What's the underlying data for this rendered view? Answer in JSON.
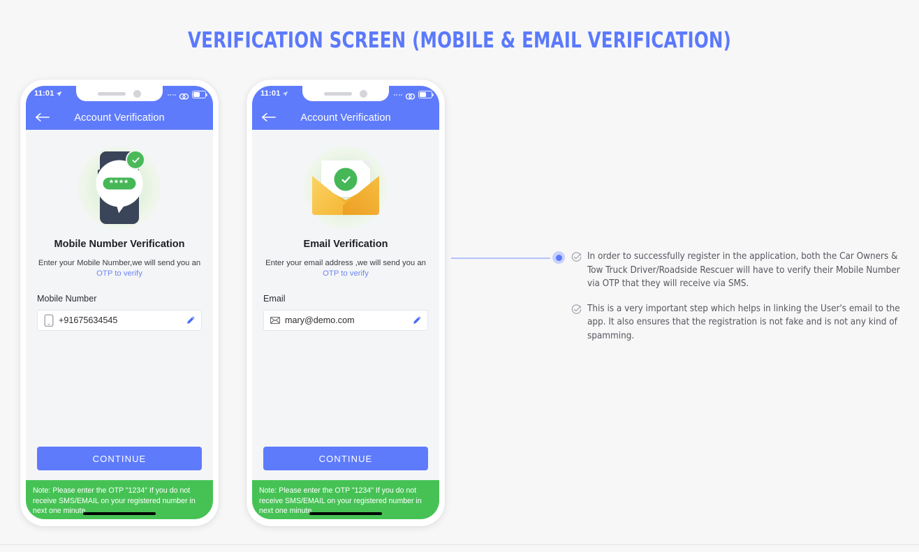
{
  "title": "VERIFICATION SCREEN (MOBILE & EMAIL VERIFICATION)",
  "colors": {
    "accent_blue": "#5e7bfc",
    "title_blue": "#5b79fb",
    "note_green": "#46c255",
    "check_green": "#46b757",
    "envelope_orange": "#f0a62a",
    "page_bg": "#f7f7f8",
    "screen_bg": "#f4f5f7"
  },
  "phones": [
    {
      "id": "mobile-verification",
      "status_bar": {
        "time": "11:01",
        "location_icon": "location-arrow-icon",
        "signal_icon": "signal-dots-icon",
        "connection_icon": "chain-link-icon",
        "battery_icon": "battery-icon"
      },
      "appbar": {
        "back_icon": "back-arrow-icon",
        "title": "Account Verification"
      },
      "illustration": {
        "name": "mobile-otp-illustration",
        "otp_mask": "****",
        "badge_icon": "green-check-badge-icon"
      },
      "section_title": "Mobile Number  Verification",
      "section_subtitle": "Enter your Mobile Number,we will send you an",
      "section_link": "OTP to verify",
      "field": {
        "label": "Mobile Number",
        "icon": "phone-icon",
        "value": "+91675634545",
        "placeholder": "+91675634545",
        "edit_icon": "pencil-icon"
      },
      "cta_label": "CONTINUE",
      "note": "Note: Please enter the OTP \"1234\" If you do not receive SMS/EMAIL on your registered number in next one minute."
    },
    {
      "id": "email-verification",
      "status_bar": {
        "time": "11:01",
        "location_icon": "location-arrow-icon",
        "signal_icon": "signal-dots-icon",
        "connection_icon": "chain-link-icon",
        "battery_icon": "battery-icon"
      },
      "appbar": {
        "back_icon": "back-arrow-icon",
        "title": "Account Verification"
      },
      "illustration": {
        "name": "email-envelope-illustration",
        "badge_icon": "green-check-badge-icon"
      },
      "section_title": "Email Verification",
      "section_subtitle": "Enter your email address ,we will send you an",
      "section_link": "OTP to verify",
      "field": {
        "label": "Email",
        "icon": "envelope-icon",
        "value": "mary@demo.com",
        "placeholder": "mary@demo.com",
        "edit_icon": "pencil-icon"
      },
      "cta_label": "CONTINUE",
      "note": "Note: Please enter the OTP \"1234\" If you do not receive SMS/EMAIL on your registered number in next one minute."
    }
  ],
  "annotations": {
    "connector": {
      "dot_icon": "connector-dot-icon"
    },
    "items": [
      {
        "icon": "circle-check-icon",
        "text": "In order to successfully register in the application, both the Car Owners & Tow Truck Driver/Roadside Rescuer will have to verify their Mobile Number via OTP that they will receive via SMS."
      },
      {
        "icon": "circle-check-icon",
        "text": "This is a very important step which helps in linking the User's email to the app. It also ensures that the registration is not fake and is not any kind of spamming."
      }
    ]
  }
}
